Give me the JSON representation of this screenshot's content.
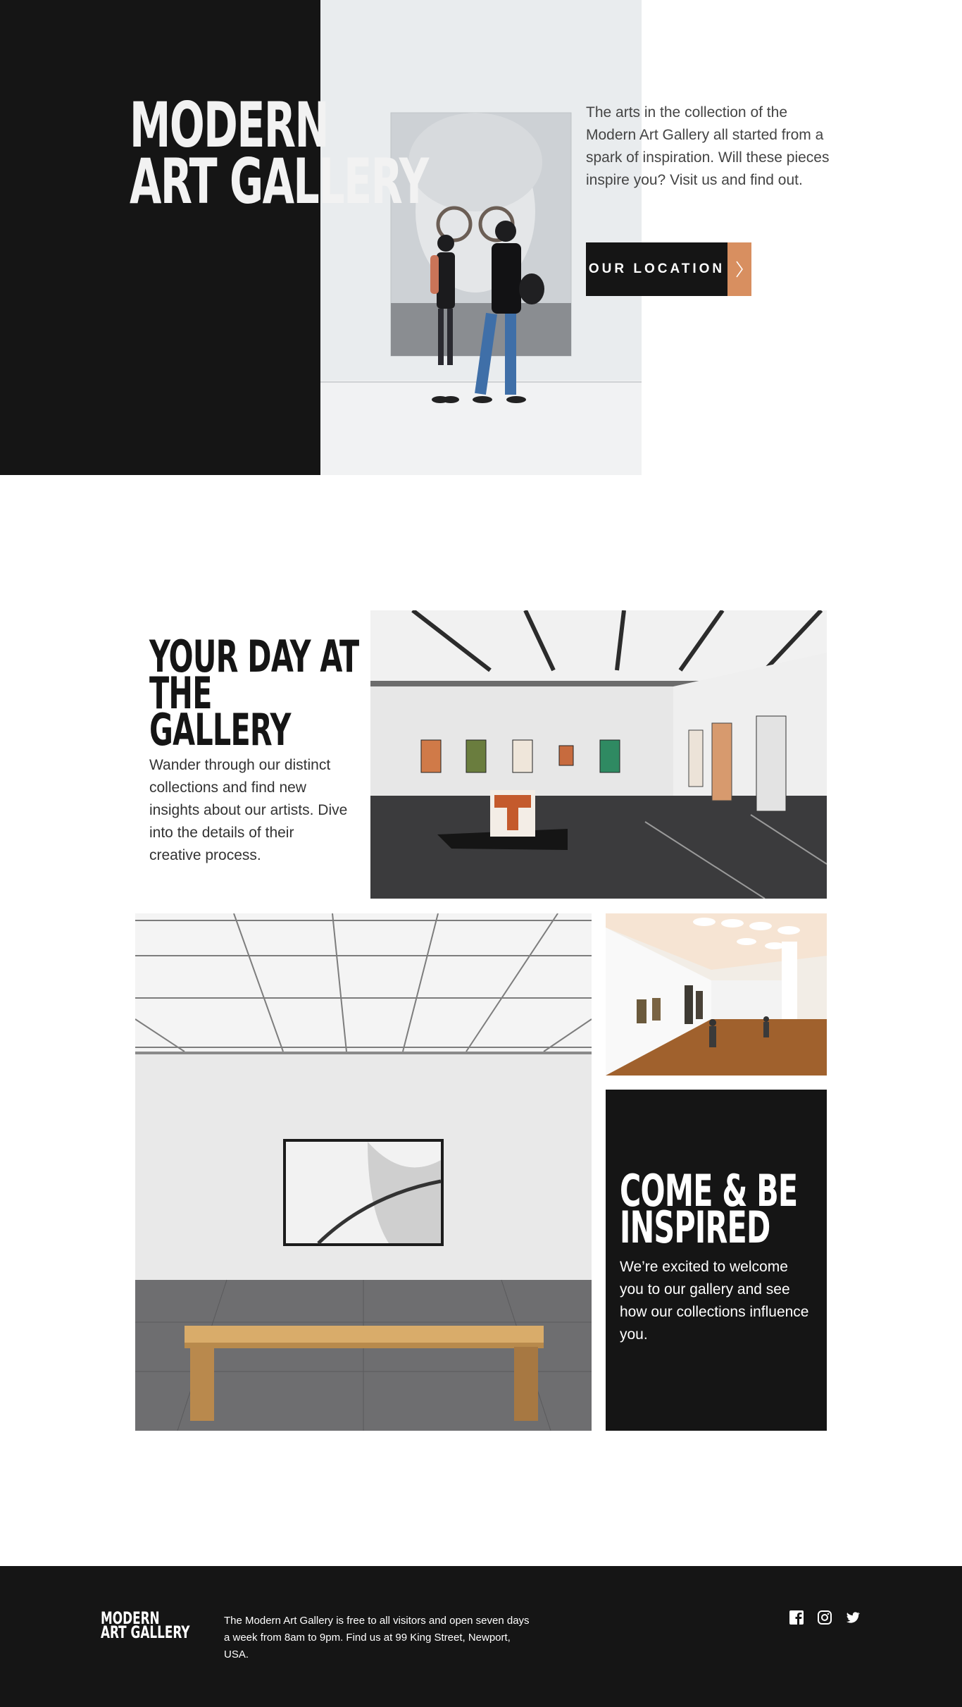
{
  "hero": {
    "title_line1": "MODERN",
    "title_line2": "ART GALLERY",
    "description": "The arts in the collection of the Modern Art Gallery all started from a spark of inspiration. Will these pieces inspire you? Visit us and find out.",
    "cta_label": "OUR LOCATION",
    "accent_color": "#d88f60"
  },
  "day": {
    "title_line1": "YOUR DAY AT",
    "title_line2": "THE",
    "title_line3": "GALLERY",
    "description": "Wander through our distinct collections and find new insights about our artists. Dive into the details of their creative process."
  },
  "inspired": {
    "title_line1": "COME & BE",
    "title_line2": "INSPIRED",
    "description": "We’re excited to welcome you to our gallery and see how our collections influence you."
  },
  "footer": {
    "logo_line1": "MODERN",
    "logo_line2": "ART GALLERY",
    "info": "The Modern Art Gallery is free to all visitors and open seven days a week from 8am to 9pm. Find us at 99 King Street, Newport, USA.",
    "social_icons": [
      "facebook-icon",
      "instagram-icon",
      "twitter-icon"
    ]
  },
  "colors": {
    "dark": "#151515",
    "accent": "#d88f60",
    "text_gray": "#444444"
  }
}
